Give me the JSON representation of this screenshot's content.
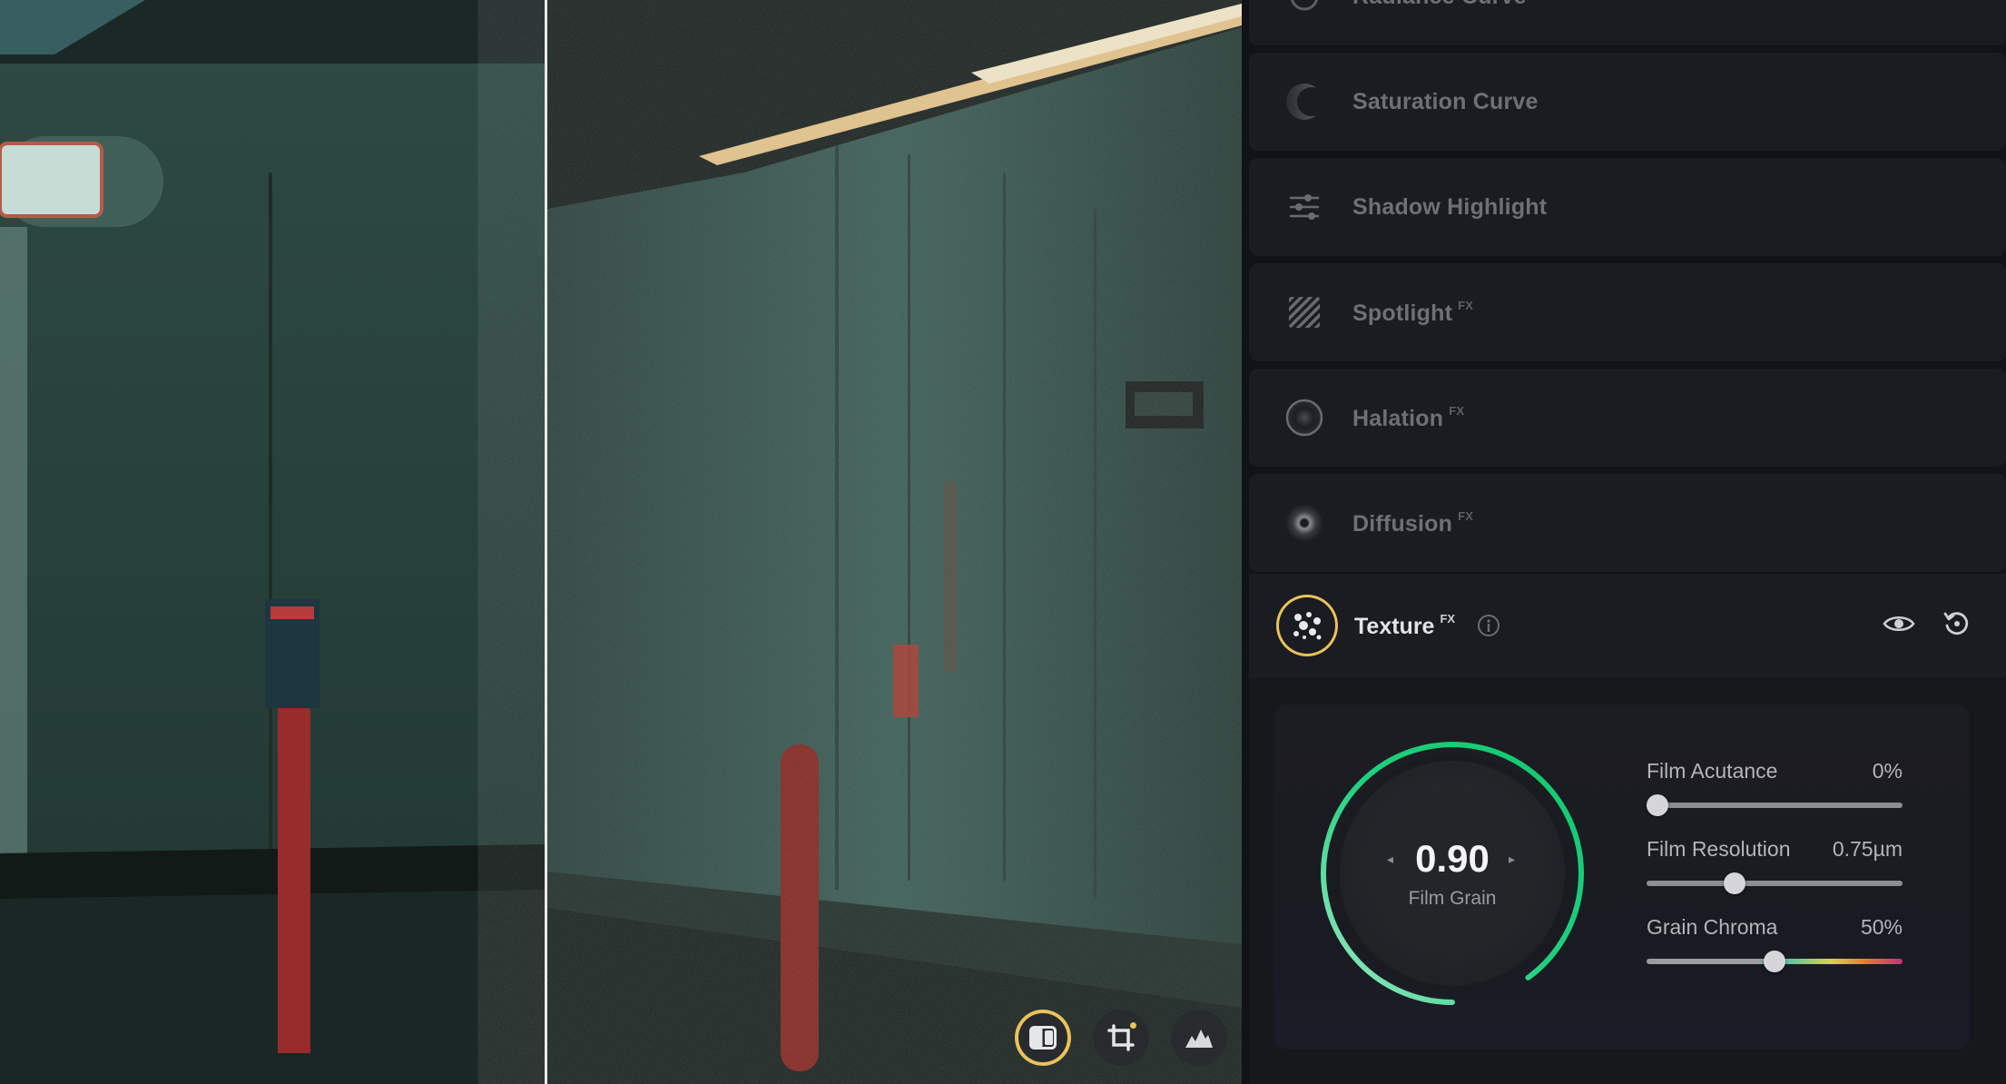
{
  "viewer": {
    "toolbar": [
      {
        "id": "compare",
        "icon": "split-compare-icon",
        "active": true
      },
      {
        "id": "crop",
        "icon": "crop-icon",
        "active": false,
        "badge": true
      },
      {
        "id": "histogram",
        "icon": "histogram-icon",
        "active": false
      }
    ]
  },
  "panel": {
    "rows": [
      {
        "label": "Radiance Curve",
        "fx": "",
        "icon": "radiance-curve-icon"
      },
      {
        "label": "Saturation Curve",
        "fx": "",
        "icon": "half-moon-icon"
      },
      {
        "label": "Shadow Highlight",
        "fx": "",
        "icon": "sliders-icon"
      },
      {
        "label": "Spotlight",
        "fx": "FX",
        "icon": "diagonal-stripes-icon"
      },
      {
        "label": "Halation",
        "fx": "FX",
        "icon": "halation-ring-icon"
      },
      {
        "label": "Diffusion",
        "fx": "FX",
        "icon": "diffusion-glow-icon"
      }
    ],
    "texture": {
      "label": "Texture",
      "fx": "FX",
      "dial": {
        "value": "0.90",
        "caption": "Film Grain",
        "fraction": 0.9
      },
      "sliders": [
        {
          "label": "Film Acutance",
          "value": "0%",
          "position": 0.0,
          "style": "plain"
        },
        {
          "label": "Film Resolution",
          "value": "0.75µm",
          "position": 0.33,
          "style": "plain"
        },
        {
          "label": "Grain Chroma",
          "value": "50%",
          "position": 0.5,
          "style": "chroma"
        }
      ]
    },
    "colors": {
      "accent": "#e9c25a",
      "dial_green": "#22d07a"
    }
  }
}
